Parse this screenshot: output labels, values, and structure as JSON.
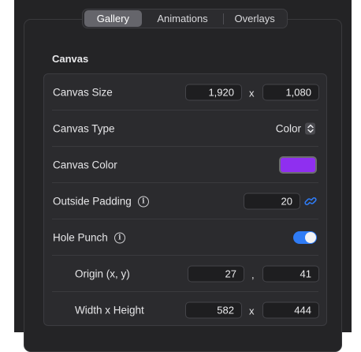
{
  "tabs": [
    {
      "label": "Gallery",
      "active": true
    },
    {
      "label": "Animations",
      "active": false
    },
    {
      "label": "Overlays",
      "active": false
    }
  ],
  "section": {
    "title": "Canvas"
  },
  "canvas_size": {
    "label": "Canvas Size",
    "width": "1,920",
    "separator": "x",
    "height": "1,080"
  },
  "canvas_type": {
    "label": "Canvas Type",
    "value": "Color",
    "icon": "chevron-up-down-icon"
  },
  "canvas_color": {
    "label": "Canvas Color",
    "color": "#8f2ff0"
  },
  "outside_padding": {
    "label": "Outside Padding",
    "value": "20",
    "info_icon": "info-icon",
    "link_icon": "link-icon"
  },
  "hole_punch": {
    "label": "Hole Punch",
    "enabled": true,
    "info_icon": "info-icon"
  },
  "origin": {
    "label": "Origin (x, y)",
    "x": "27",
    "separator": ",",
    "y": "41"
  },
  "size": {
    "label": "Width x Height",
    "width": "582",
    "separator": "x",
    "height": "444"
  },
  "colors": {
    "accent": "#2f7cf6",
    "background": "#232325"
  }
}
